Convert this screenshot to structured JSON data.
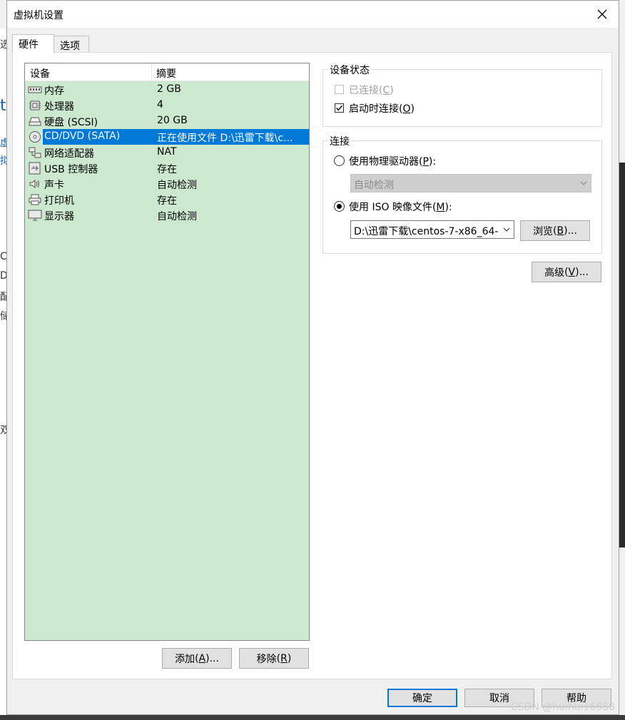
{
  "window": {
    "title": "虚拟机设置"
  },
  "tabs": [
    {
      "label": "硬件"
    },
    {
      "label": "选项"
    }
  ],
  "background_fragments": [
    "选",
    "t",
    "虚",
    "拟",
    "C",
    "D",
    "配",
    "储",
    "双"
  ],
  "device_list": {
    "headers": {
      "device": "设备",
      "summary": "摘要"
    },
    "rows": [
      {
        "icon": "memory-icon",
        "name": "内存",
        "summary": "2 GB"
      },
      {
        "icon": "processor-icon",
        "name": "处理器",
        "summary": "4"
      },
      {
        "icon": "harddisk-icon",
        "name": "硬盘 (SCSI)",
        "summary": "20 GB"
      },
      {
        "icon": "cd-dvd-icon",
        "name": "CD/DVD (SATA)",
        "summary": "正在使用文件 D:\\迅雷下载\\c..."
      },
      {
        "icon": "network-adapter-icon",
        "name": "网络适配器",
        "summary": "NAT"
      },
      {
        "icon": "usb-icon",
        "name": "USB 控制器",
        "summary": "存在"
      },
      {
        "icon": "sound-icon",
        "name": "声卡",
        "summary": "自动检测"
      },
      {
        "icon": "printer-icon",
        "name": "打印机",
        "summary": "存在"
      },
      {
        "icon": "display-icon",
        "name": "显示器",
        "summary": "自动检测"
      }
    ],
    "selected_name": "CD/DVD (SATA)"
  },
  "device_status": {
    "title": "设备状态",
    "connected": {
      "label": "已连接",
      "mnemonic": "C",
      "checked": false,
      "enabled": false
    },
    "connect_at_poweron": {
      "label": "启动时连接",
      "mnemonic": "O",
      "checked": true,
      "enabled": true
    }
  },
  "connection": {
    "title": "连接",
    "physical_drive": {
      "label": "使用物理驱动器",
      "mnemonic": "P",
      "selected": false
    },
    "physical_drive_value": "自动检测",
    "iso_image": {
      "label": "使用 ISO 映像文件",
      "mnemonic": "M",
      "selected": true
    },
    "iso_path": "D:\\迅雷下载\\centos-7-x86_64-",
    "browse": {
      "label": "浏览",
      "mnemonic": "B"
    }
  },
  "advanced": {
    "label": "高级",
    "mnemonic": "V"
  },
  "list_buttons": {
    "add": {
      "label": "添加",
      "mnemonic": "A"
    },
    "remove": {
      "label": "移除",
      "mnemonic": "R"
    }
  },
  "footer": {
    "ok": "确定",
    "cancel": "取消",
    "help": "帮助"
  },
  "watermark": "CSDN @huihui16688",
  "colors": {
    "list_background": "#cce8cf",
    "selection": "#0078d7",
    "dialog_background": "#f0f0f0"
  }
}
